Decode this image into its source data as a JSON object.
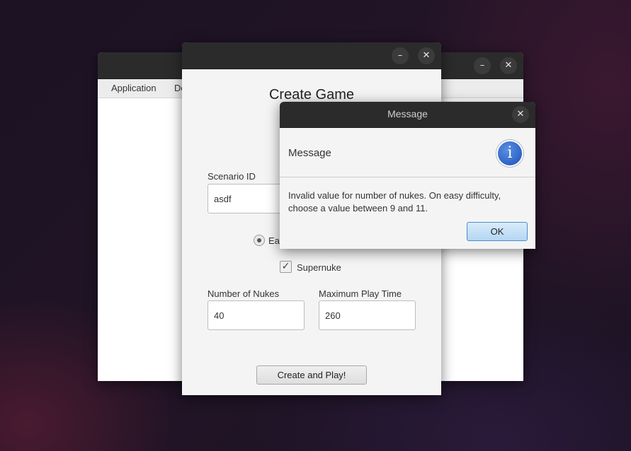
{
  "back_window": {
    "menu": [
      "Application",
      "De"
    ]
  },
  "create_window": {
    "heading": "Create Game",
    "scenario_label": "Scenario ID",
    "scenario_value": "asdf",
    "difficulty_partial": "Ea",
    "supernuke_label": "Supernuke",
    "supernuke_checked": "✓",
    "nukes_label": "Number of Nukes",
    "nukes_value": "40",
    "playtime_label": "Maximum Play Time",
    "playtime_value": "260",
    "create_button": "Create and Play!"
  },
  "window_controls": {
    "minimize": "–",
    "close": "✕"
  },
  "message_dialog": {
    "title": "Message",
    "header": "Message",
    "info_glyph": "i",
    "text_line1": "Invalid value for number of nukes. On easy difficulty,",
    "text_line2": "choose a value between 9 and 11.",
    "ok_button": "OK"
  }
}
